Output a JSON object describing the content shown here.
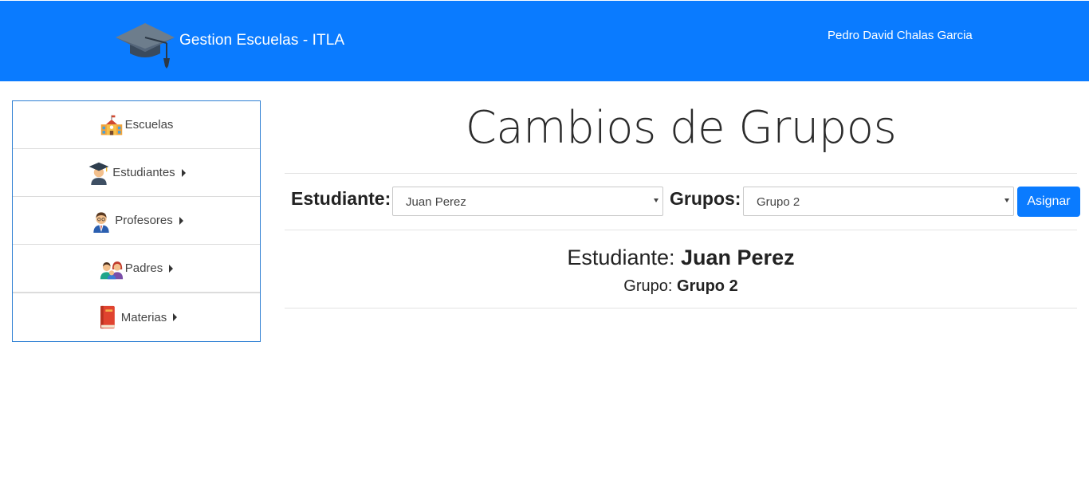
{
  "header": {
    "brand_text": "Gestion Escuelas - ITLA",
    "user_name": "Pedro David Chalas Garcia",
    "logo_icon": "graduation-cap-icon",
    "bg_color": "#0a7bff"
  },
  "sidebar": {
    "items": [
      {
        "label": "Escuelas",
        "icon": "school-building-icon",
        "has_caret": false
      },
      {
        "label": "Estudiantes",
        "icon": "graduate-student-icon",
        "has_caret": true
      },
      {
        "label": "Profesores",
        "icon": "teacher-icon",
        "has_caret": true
      },
      {
        "label": "Padres",
        "icon": "family-icon",
        "has_caret": true
      },
      {
        "label": "Materias",
        "icon": "book-icon",
        "has_caret": true
      }
    ]
  },
  "main": {
    "title": "Cambios de Grupos",
    "student_label": "Estudiante:",
    "student_selected": "Juan Perez",
    "group_label": "Grupos:",
    "group_selected": "Grupo 2",
    "assign_button": "Asignar",
    "summary": {
      "student_prefix": "Estudiante:",
      "student_value": "Juan Perez",
      "group_prefix": "Grupo:",
      "group_value": "Grupo 2"
    }
  }
}
